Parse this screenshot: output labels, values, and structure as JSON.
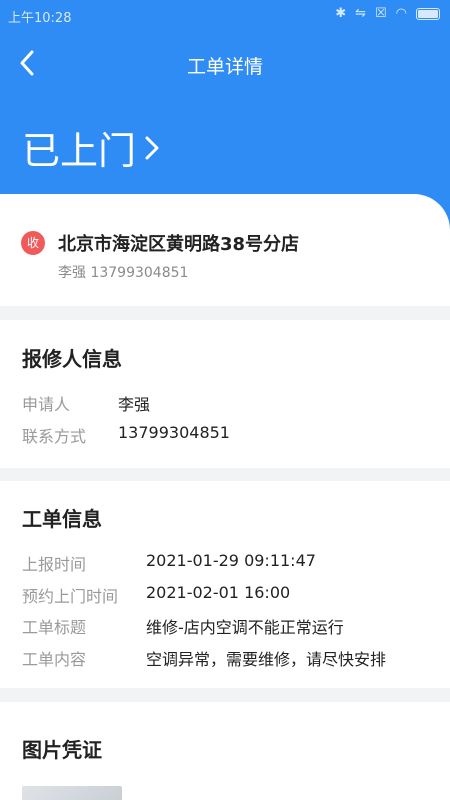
{
  "statusbar": {
    "time": "上午10:28"
  },
  "nav": {
    "title": "工单详情"
  },
  "status": {
    "label": "已上门"
  },
  "address": {
    "badge": "收",
    "name": "北京市海淀区黄明路38号分店",
    "contact": "李强 13799304851"
  },
  "reporter": {
    "title": "报修人信息",
    "rows": [
      {
        "label": "申请人",
        "value": "李强"
      },
      {
        "label": "联系方式",
        "value": "13799304851"
      }
    ]
  },
  "order": {
    "title": "工单信息",
    "rows": [
      {
        "label": "上报时间",
        "value": "2021-01-29 09:11:47"
      },
      {
        "label": "预约上门时间",
        "value": "2021-02-01 16:00"
      },
      {
        "label": "工单标题",
        "value": "维修-店内空调不能正常运行"
      },
      {
        "label": "工单内容",
        "value": "空调异常，需要维修，请尽快安排"
      }
    ]
  },
  "photos": {
    "title": "图片凭证"
  },
  "colors": {
    "primary": "#2f8cf5",
    "badge": "#f15a5a"
  }
}
